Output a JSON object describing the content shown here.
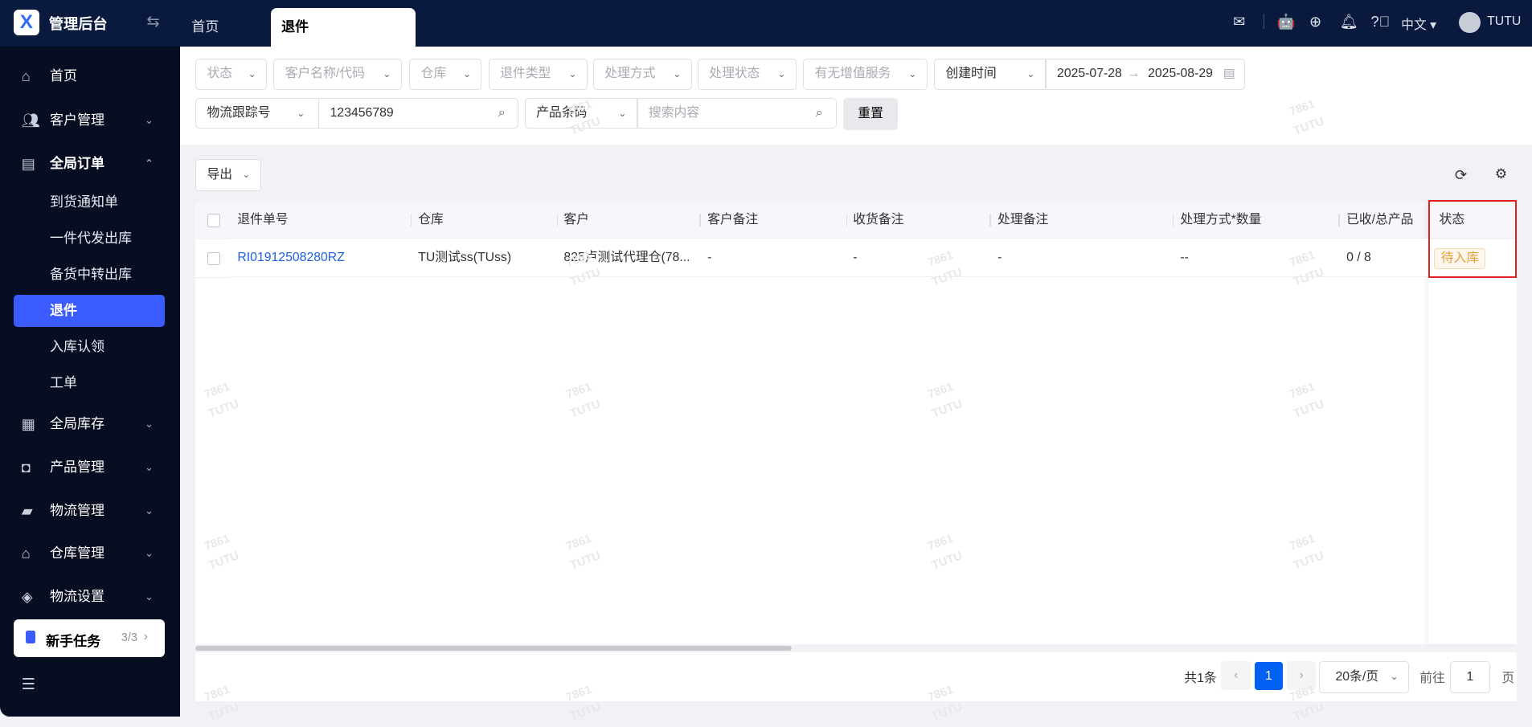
{
  "app": {
    "title": "管理后台",
    "logo": "X"
  },
  "tabs": [
    {
      "label": "首页"
    },
    {
      "label": "退件"
    }
  ],
  "header": {
    "language": "中文",
    "user": "TUTU"
  },
  "sidebar": {
    "items": [
      {
        "label": "首页",
        "icon": "home-icon"
      },
      {
        "label": "客户管理",
        "icon": "users-icon"
      },
      {
        "label": "全局订单",
        "icon": "clipboard-icon",
        "children": [
          "到货通知单",
          "一件代发出库",
          "备货中转出库",
          "退件",
          "入库认领",
          "工单"
        ]
      },
      {
        "label": "全局库存",
        "icon": "warehouse-icon"
      },
      {
        "label": "产品管理",
        "icon": "bag-icon"
      },
      {
        "label": "物流管理",
        "icon": "truck-icon"
      },
      {
        "label": "仓库管理",
        "icon": "store-icon"
      },
      {
        "label": "物流设置",
        "icon": "box-icon"
      }
    ],
    "active": "退件",
    "task": {
      "label": "新手任务",
      "progress": "3/3"
    }
  },
  "filters": {
    "selects": [
      "状态",
      "客户名称/代码",
      "仓库",
      "退件类型",
      "处理方式",
      "处理状态",
      "有无增值服务"
    ],
    "date_type": "创建时间",
    "date_start": "2025-07-28",
    "date_end": "2025-08-29",
    "tracking_type": "物流跟踪号",
    "tracking_value": "123456789",
    "product_type": "产品条码",
    "product_placeholder": "搜索内容",
    "reset": "重置"
  },
  "toolbar": {
    "export": "导出"
  },
  "table": {
    "columns": [
      "退件单号",
      "仓库",
      "客户",
      "客户备注",
      "收货备注",
      "处理备注",
      "处理方式*数量",
      "已收/总产品",
      "状态"
    ],
    "rows": [
      {
        "id": "RI01912508280RZ",
        "warehouse": "TU测试ss(TUss)",
        "customer": "825卢测试代理仓(78...",
        "customer_note": "-",
        "receive_note": "-",
        "process_note": "-",
        "method_qty": "--",
        "received": "0 / 8",
        "status": "待入库"
      }
    ]
  },
  "pagination": {
    "total": "共1条",
    "current": "1",
    "page_size": "20条/页",
    "goto_label": "前往",
    "goto_value": "1",
    "page_suffix": "页"
  },
  "watermark": {
    "line1": "7861",
    "line2": "TUTU"
  },
  "colors": {
    "accent": "#3a5bfd",
    "link": "#1f5ee8",
    "status_bg": "#fdf6ec",
    "status_text": "#e6a23c",
    "highlight": "#e02020"
  }
}
